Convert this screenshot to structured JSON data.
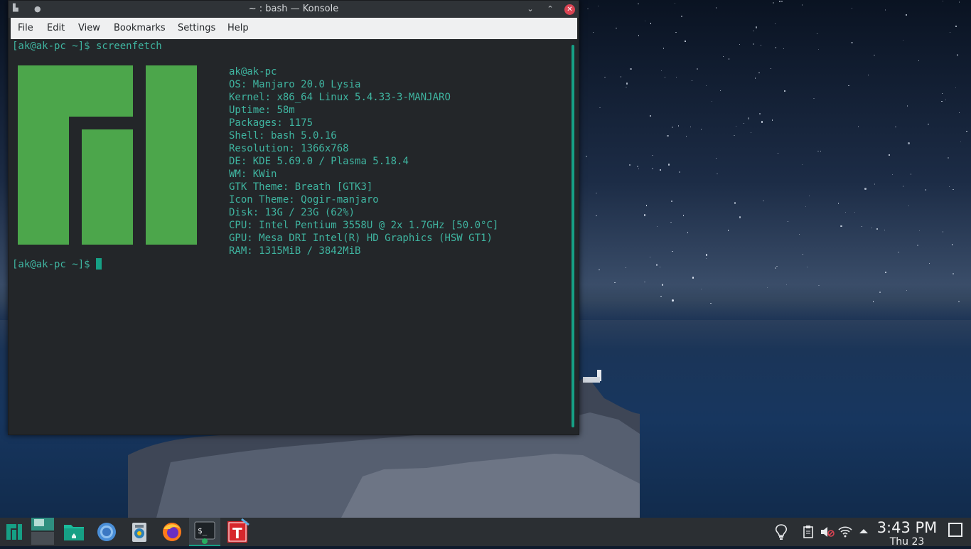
{
  "window": {
    "title": "~ : bash — Konsole",
    "minimize_glyph": "⌄",
    "maximize_glyph": "⌃",
    "close_glyph": "✕"
  },
  "menubar": {
    "items": [
      "File",
      "Edit",
      "View",
      "Bookmarks",
      "Settings",
      "Help"
    ]
  },
  "terminal": {
    "command_line": "[ak@ak-pc ~]$ screenfetch",
    "prompt_line": "[ak@ak-pc ~]$ ",
    "info": {
      "user_host": "ak@ak-pc",
      "rows": [
        {
          "key": "OS:",
          "value": " Manjaro 20.0 Lysia"
        },
        {
          "key": "Kernel:",
          "value": " x86_64 Linux 5.4.33-3-MANJARO"
        },
        {
          "key": "Uptime:",
          "value": " 58m"
        },
        {
          "key": "Packages:",
          "value": " 1175"
        },
        {
          "key": "Shell:",
          "value": " bash 5.0.16"
        },
        {
          "key": "Resolution:",
          "value": " 1366x768"
        },
        {
          "key": "DE:",
          "value": " KDE 5.69.0 / Plasma 5.18.4"
        },
        {
          "key": "WM:",
          "value": " KWin"
        },
        {
          "key": "GTK Theme:",
          "value": " Breath [GTK3]"
        },
        {
          "key": "Icon Theme:",
          "value": " Qogir-manjaro"
        },
        {
          "key": "Disk:",
          "value": " 13G / 23G (62%)"
        },
        {
          "key": "CPU:",
          "value": " Intel Pentium 3558U @ 2x 1.7GHz [50.0°C]"
        },
        {
          "key": "GPU:",
          "value": " Mesa DRI Intel(R) HD Graphics (HSW GT1)"
        },
        {
          "key": "RAM:",
          "value": " 1315MiB / 3842MiB"
        }
      ]
    },
    "logo_color": "#4ca64b",
    "text_color": "#3fb4a0"
  },
  "taskbar": {
    "apps": [
      {
        "name": "manjaro-menu-icon"
      },
      {
        "name": "virtual-desktop-pager-icon"
      },
      {
        "name": "file-manager-icon"
      },
      {
        "name": "chromium-icon"
      },
      {
        "name": "software-manager-icon"
      },
      {
        "name": "firefox-icon"
      },
      {
        "name": "konsole-icon",
        "label": "$_"
      },
      {
        "name": "typora-icon",
        "label": "T"
      }
    ],
    "tray": [
      "lightbulb-icon",
      "clipboard-icon",
      "volume-muted-icon",
      "wifi-icon",
      "expand-tray-icon"
    ],
    "clock": {
      "time": "3:43 PM",
      "date": "Thu 23"
    }
  }
}
